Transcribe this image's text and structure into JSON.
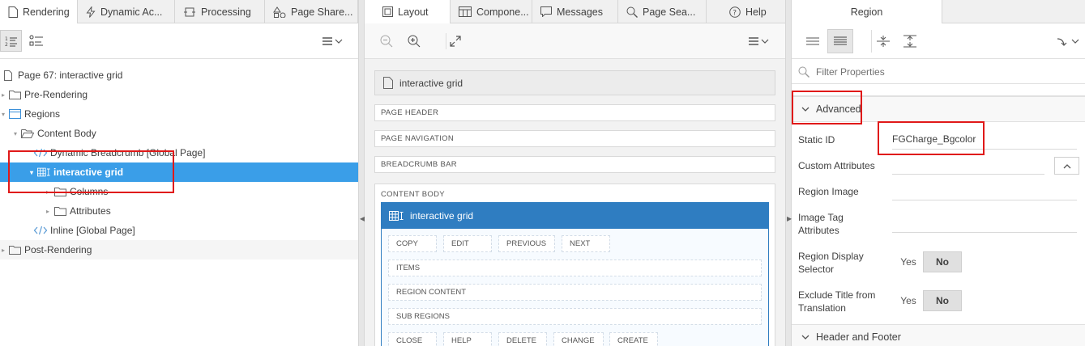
{
  "left": {
    "tabs": [
      {
        "label": "Rendering",
        "icon": "page-icon"
      },
      {
        "label": "Dynamic Ac...",
        "icon": "lightning-icon"
      },
      {
        "label": "Processing",
        "icon": "process-icon"
      },
      {
        "label": "Page Share...",
        "icon": "shapes-icon"
      }
    ],
    "tree": [
      {
        "label": "Page 67: interactive grid",
        "icon": "page-icon"
      },
      {
        "label": "Pre-Rendering",
        "icon": "folder-icon"
      },
      {
        "label": "Regions",
        "icon": "region-icon"
      },
      {
        "label": "Content Body",
        "icon": "folder-open-icon"
      },
      {
        "label": "Dynamic Breadcrumb [Global Page]",
        "icon": "code-icon"
      },
      {
        "label": "interactive grid",
        "icon": "grid-icon"
      },
      {
        "label": "Columns",
        "icon": "folder-icon"
      },
      {
        "label": "Attributes",
        "icon": "folder-icon"
      },
      {
        "label": "Inline [Global Page]",
        "icon": "code-icon"
      },
      {
        "label": "Post-Rendering",
        "icon": "folder-icon"
      }
    ]
  },
  "middle": {
    "tabs": [
      {
        "label": "Layout",
        "icon": "layout-icon"
      },
      {
        "label": "Compone...",
        "icon": "component-icon"
      },
      {
        "label": "Messages",
        "icon": "message-icon"
      },
      {
        "label": "Page Sea...",
        "icon": "search-icon"
      },
      {
        "label": "Help",
        "icon": "help-icon"
      }
    ],
    "page_title": "interactive grid",
    "bars": [
      "PAGE HEADER",
      "PAGE NAVIGATION",
      "BREADCRUMB BAR",
      "CONTENT BODY"
    ],
    "region_title": "interactive grid",
    "region_buttons_row1": [
      "COPY",
      "EDIT",
      "PREVIOUS",
      "NEXT"
    ],
    "region_items": [
      "ITEMS",
      "REGION CONTENT",
      "SUB REGIONS"
    ],
    "region_buttons_row2": [
      "CLOSE",
      "HELP",
      "DELETE",
      "CHANGE",
      "CREATE"
    ]
  },
  "right": {
    "tab": "Region",
    "filter_placeholder": "Filter Properties",
    "section_advanced": "Advanced",
    "props": {
      "static_id_label": "Static ID",
      "static_id_value": "FGCharge_Bgcolor",
      "custom_attributes_label": "Custom Attributes",
      "region_image_label": "Region Image",
      "image_tag_label": "Image Tag Attributes",
      "region_display_selector_label": "Region Display Selector",
      "exclude_title_label": "Exclude Title from Translation",
      "yes": "Yes",
      "no": "No"
    },
    "section_header_footer": "Header and Footer"
  },
  "colors": {
    "selected_row": "#3a9ee8",
    "region_header": "#2f7dc1",
    "highlight_box": "#e01919"
  }
}
